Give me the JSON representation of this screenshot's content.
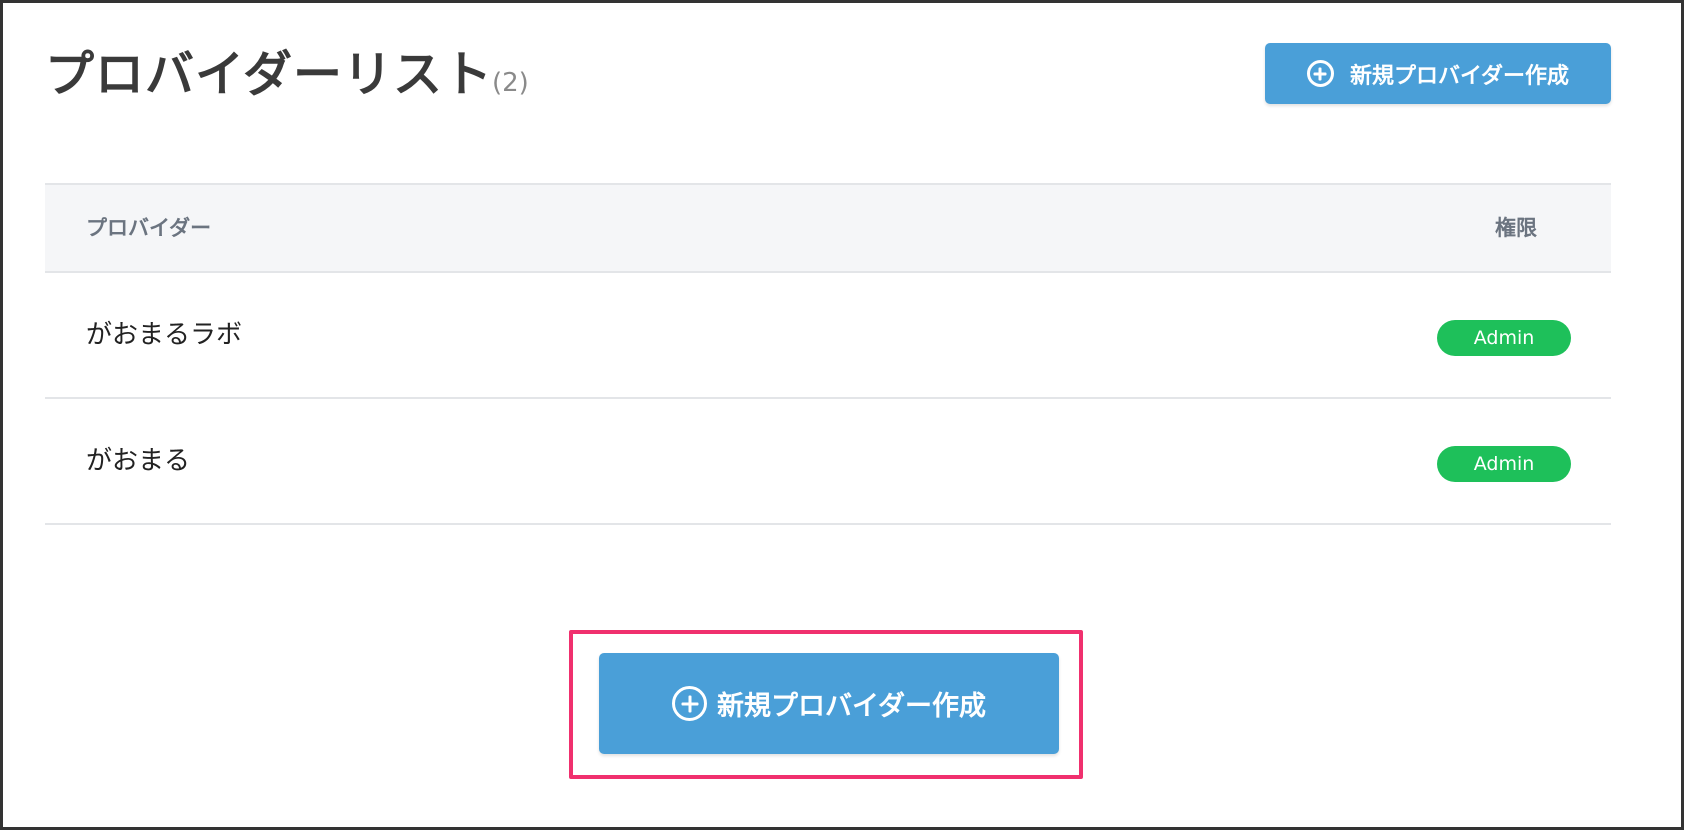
{
  "header": {
    "title": "プロバイダーリスト",
    "count": "(2)"
  },
  "actions": {
    "create_label": "新規プロバイダー作成"
  },
  "table": {
    "columns": [
      "プロバイダー",
      "権限"
    ],
    "rows": [
      {
        "name": "がおまるラボ",
        "role": "Admin"
      },
      {
        "name": "がおまる",
        "role": "Admin"
      }
    ]
  },
  "colors": {
    "primary_button": "#4a9fd8",
    "admin_badge": "#1ec05a",
    "highlight_border": "#f0306e"
  },
  "icons": {
    "create": "plus-circle-icon"
  }
}
